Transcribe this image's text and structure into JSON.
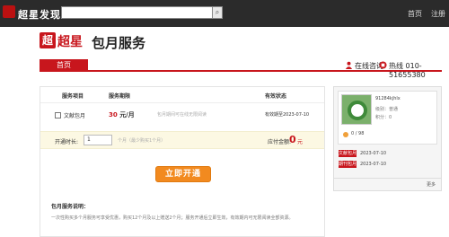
{
  "topbar": {
    "logo_text": "超星发现",
    "search_placeholder": "",
    "search_button": "⌕",
    "nav": [
      "首页",
      "注册"
    ]
  },
  "brand": {
    "logo_mark": "超",
    "logo_text": "超星",
    "title": "包月服务"
  },
  "tabs": {
    "home": "首页",
    "online_consult": "在线咨询",
    "hotline": "热线 010-51655380"
  },
  "table": {
    "headers": [
      "服务项目",
      "服务期限",
      "有效状态"
    ],
    "row": {
      "item": "文献包月",
      "price_num": "30",
      "price_unit": "元/月",
      "note": "包月期间可在线无限阅读",
      "validity": "有效期至2023-07-10"
    }
  },
  "purchase": {
    "label": "开通时长:",
    "quantity": "1",
    "unit_hint": "个月（最少购买1个月）",
    "total_label": "应付金额:",
    "total_value": "0",
    "total_unit": "元"
  },
  "open_button": "立即开通",
  "notes": {
    "title": "包月服务说明：",
    "text": "一次性购买多个月服务可享受优惠，购买12个月及以上赠送2个月；服务开通后立即生效，有效期内可无限阅读全部资源。"
  },
  "side": {
    "username": "91284kjhlx",
    "line1": "级别：普通",
    "line2": "积分：0",
    "score": "0 / 98",
    "badges": [
      {
        "label": "文献包月",
        "date": "2023-07-10"
      },
      {
        "label": "期刊包月",
        "date": "2023-07-10"
      }
    ],
    "more": "更多"
  },
  "colors": {
    "brand_red": "#c8161d",
    "button_orange": "#f28a1f",
    "topbar": "#2b2b2b"
  }
}
